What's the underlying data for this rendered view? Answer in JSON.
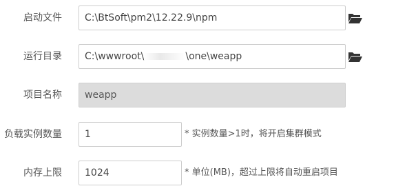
{
  "fields": {
    "start_file": {
      "label": "启动文件",
      "value": "C:\\BtSoft\\pm2\\12.22.9\\npm"
    },
    "run_dir": {
      "label": "运行目录",
      "value_prefix": "C:\\wwwroot\\",
      "value_suffix": "\\one\\weapp"
    },
    "project_name": {
      "label": "项目名称",
      "value": "weapp"
    },
    "instances": {
      "label": "负载实例数量",
      "value": "1",
      "hint": "* 实例数量>1时，将开启集群模式"
    },
    "memory_limit": {
      "label": "内存上限",
      "value": "1024",
      "hint": "* 单位(MB)，超过上限将自动重启项目"
    }
  },
  "icons": {
    "folder": "folder-open-icon"
  },
  "colors": {
    "icon": "#333333",
    "disabled_bg": "#dcdcdc",
    "border": "#cccccc"
  }
}
